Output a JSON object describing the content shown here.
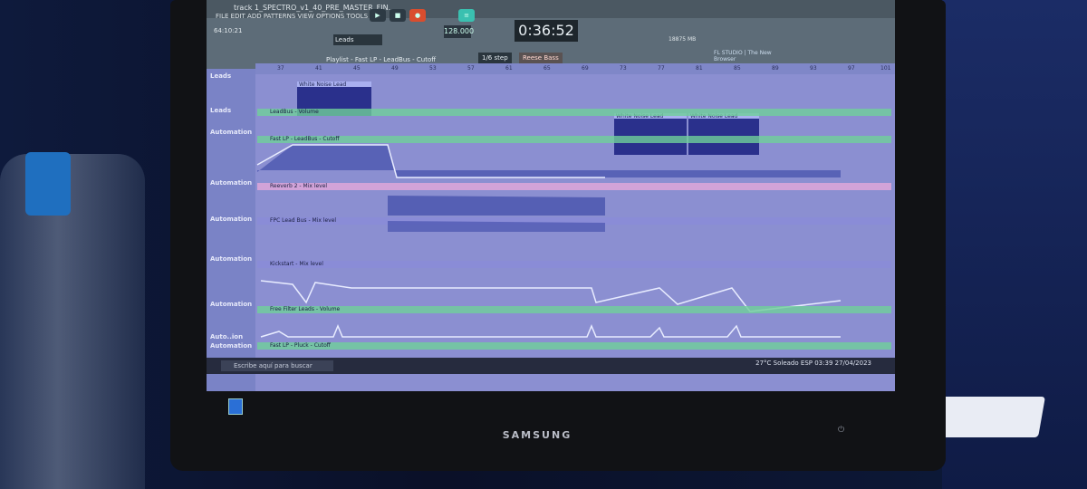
{
  "monitor": {
    "brand": "SAMSUNG"
  },
  "flstudio": {
    "title": "track 1_SPECTRO_v1_40_PRE_MASTER_FIN...",
    "menu": [
      "FILE",
      "EDIT",
      "ADD",
      "PATTERNS",
      "VIEW",
      "OPTIONS",
      "TOOLS",
      "?"
    ],
    "time_hint": "64:10:21",
    "pattern": "Leads",
    "tempo": "128.000",
    "song_time": "0:36:52",
    "cpu": "18875 MB",
    "snap": "1/6 step",
    "preset": "Reese Bass",
    "news": "FL STUDIO | The New Browser",
    "playlist_title": "Playlist - Fast LP - LeadBus - Cutoff",
    "ruler": [
      "37",
      "41",
      "45",
      "49",
      "53",
      "57",
      "61",
      "65",
      "69",
      "73",
      "77",
      "81",
      "85",
      "89",
      "93",
      "97",
      "101"
    ],
    "tracks": [
      "Leads",
      "Leads",
      "Automation",
      "Automation",
      "Automation",
      "Automation",
      "Automation",
      "Auto..ion",
      "Automation"
    ],
    "clips": [
      {
        "label": "White Noise Lead"
      },
      {
        "label": "LeadBus - Volume"
      },
      {
        "label": "White Noise Lead"
      },
      {
        "label": "White Noise Lead"
      },
      {
        "label": "Fast LP - LeadBus - Cutoff"
      },
      {
        "label": "Reeverb 2 - Mix level"
      },
      {
        "label": "FPC Lead Bus - Mix level"
      },
      {
        "label": "Kickstart - Mix level"
      },
      {
        "label": "Free Filter Leads - Volume"
      },
      {
        "label": "Fast LP - Pluck - Cutoff"
      }
    ]
  },
  "taskbar": {
    "search": "Escribe aquí para buscar",
    "weather": "27°C  Soleado",
    "lang": "ESP",
    "clock": "03:39",
    "date": "27/04/2023"
  },
  "colors": {
    "playlist_bg": "#8b8fd1",
    "automation_fill": "#3e4aa8",
    "automation_line": "#e8ecff",
    "clip_header_green": "#6fcf9a"
  }
}
